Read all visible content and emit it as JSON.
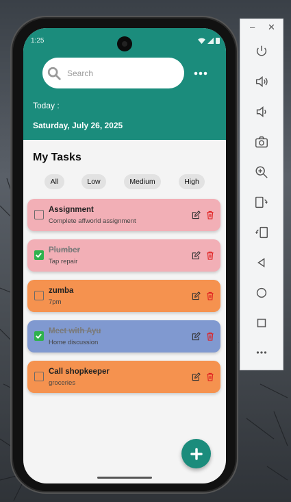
{
  "status_bar": {
    "time": "1:25"
  },
  "search": {
    "placeholder": "Search"
  },
  "header": {
    "today_label": "Today :",
    "date": "Saturday, July 26, 2025"
  },
  "section_title": "My Tasks",
  "filters": [
    "All",
    "Low",
    "Medium",
    "High"
  ],
  "tasks": [
    {
      "title": "Assignment",
      "description": "Complete affworld assignment",
      "completed": false,
      "color": "#f2afb6"
    },
    {
      "title": "Plumber",
      "description": "Tap repair",
      "completed": true,
      "color": "#f2afb6"
    },
    {
      "title": "zumba",
      "description": "7pm",
      "completed": false,
      "color": "#f5924f"
    },
    {
      "title": "Meet with Ayu",
      "description": "Home discussion",
      "completed": true,
      "color": "#8099d0"
    },
    {
      "title": "Call shopkeeper",
      "description": "groceries",
      "completed": false,
      "color": "#f5924f"
    }
  ],
  "colors": {
    "header": "#1b8c7c",
    "fab": "#1b8c7c",
    "checked": "#2fb24d",
    "delete": "#e02020"
  },
  "icons": {
    "search": "search-icon",
    "more": "more-vertical-dots-icon",
    "edit": "edit-icon",
    "delete": "trash-icon",
    "add": "plus-icon",
    "checkbox": "checkbox-icon"
  },
  "emulator_panel": {
    "icons": [
      "power-icon",
      "volume-up-icon",
      "volume-down-icon",
      "camera-icon",
      "zoom-in-icon",
      "rotate-left-icon",
      "rotate-right-icon",
      "back-icon",
      "home-icon",
      "overview-icon",
      "more-icon"
    ]
  }
}
